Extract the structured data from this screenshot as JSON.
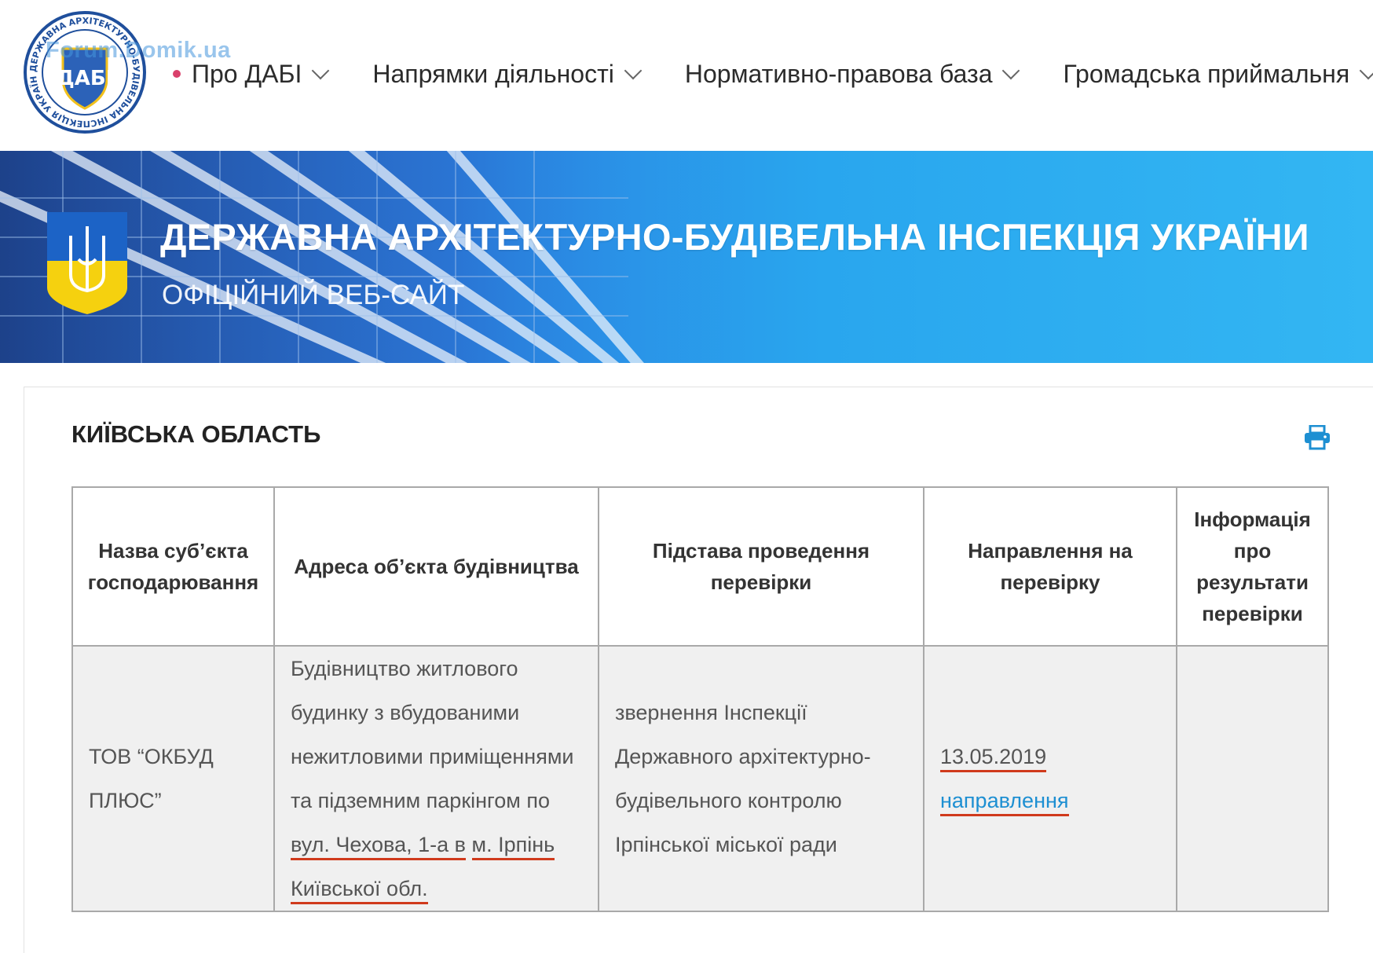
{
  "header": {
    "logo_text": "ДАБІ",
    "logo_ring_text": "ДЕРЖАВНА АРХІТЕКТУРНО-БУДІВЕЛЬНА ІНСПЕКЦІЯ УКРАЇНИ",
    "watermark": "Forum.Domik.ua"
  },
  "nav": {
    "items": [
      {
        "label": "Про ДАБІ"
      },
      {
        "label": "Напрямки діяльності"
      },
      {
        "label": "Нормативно-правова база"
      },
      {
        "label": "Громадська приймальня"
      }
    ]
  },
  "banner": {
    "title": "ДЕРЖАВНА АРХІТЕКТУРНО-БУДІВЕЛЬНА ІНСПЕКЦІЯ УКРАЇНИ",
    "subtitle": "ОФІЦІЙНИЙ ВЕБ-САЙТ"
  },
  "page": {
    "region_title": "КИЇВСЬКА ОБЛАСТЬ"
  },
  "table": {
    "headers": [
      "Назва суб’єкта господарювання",
      "Адреса об’єкта будівництва",
      "Підстава проведення перевірки",
      "Направлення на перевірку",
      "Інформація про результати перевірки"
    ],
    "rows": [
      {
        "subject": "ТОВ “ОКБУД ПЛЮС”",
        "address_plain": "Будівництво житлового будинку з вбудованими нежитловими приміщеннями та підземним паркінгом по ",
        "address_underlined_1": "вул. Чехова, 1-а в",
        "address_underlined_2": "м. Ірпінь Київської обл.",
        "basis": "звернення Інспекції Державного архітектурно-будівельного контролю Ірпінської міської ради",
        "referral_date": "13.05.2019",
        "referral_link": "направлення",
        "results": ""
      }
    ]
  },
  "colors": {
    "accent_link": "#1d8fd2",
    "underline_mark": "#d03a1c",
    "banner_blue": "#2a86e3"
  }
}
